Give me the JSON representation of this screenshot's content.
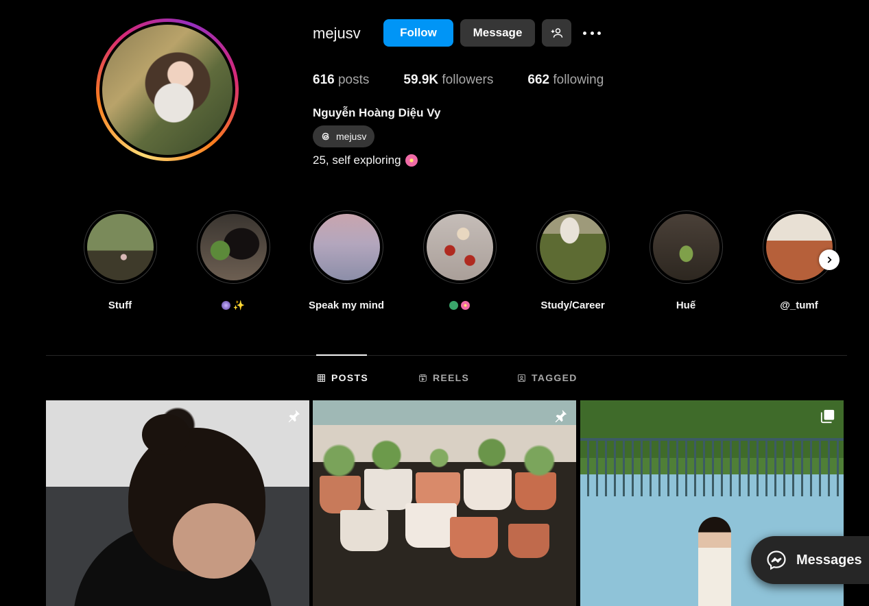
{
  "profile": {
    "username": "mejusv",
    "follow_label": "Follow",
    "message_label": "Message",
    "posts_count": "616",
    "posts_label": "posts",
    "followers_count": "59.9K",
    "followers_label": "followers",
    "following_count": "662",
    "following_label": "following",
    "full_name": "Nguyễn Hoàng Diệu Vy",
    "threads_handle": "mejusv",
    "bio": "25, self exploring"
  },
  "highlights": [
    {
      "label": "Stuff",
      "icon": "photo-forest"
    },
    {
      "label": "",
      "icon": "crystal-ball-wand-emoji"
    },
    {
      "label": "Speak my mind",
      "icon": "photo-sky-branches"
    },
    {
      "label": "",
      "icon": "leaf-flower-emoji"
    },
    {
      "label": "Study/Career",
      "icon": "photo-grass"
    },
    {
      "label": "Huế",
      "icon": "photo-gate"
    },
    {
      "label": "@_tumf",
      "icon": "photo-cards"
    }
  ],
  "tabs": [
    {
      "label": "POSTS",
      "icon": "grid-icon",
      "active": true
    },
    {
      "label": "REELS",
      "icon": "reels-icon",
      "active": false
    },
    {
      "label": "TAGGED",
      "icon": "tagged-icon",
      "active": false
    }
  ],
  "posts": [
    {
      "badge": "pin-icon"
    },
    {
      "badge": "pin-icon"
    },
    {
      "badge": "carousel-icon"
    }
  ],
  "messages_label": "Messages",
  "colors": {
    "background": "#000000",
    "follow_button": "#0095f6",
    "secondary_button": "#363636",
    "muted_text": "#a8a8a8"
  }
}
